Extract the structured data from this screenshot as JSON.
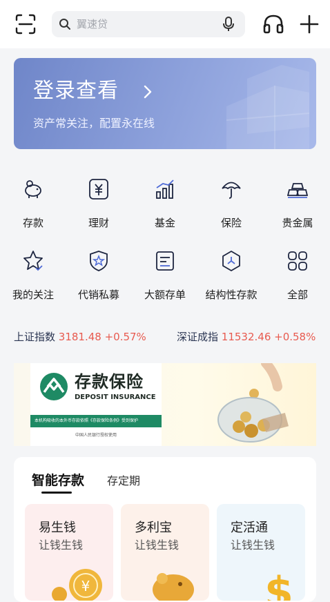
{
  "header": {
    "search_placeholder": "翼速贷"
  },
  "banner": {
    "title": "登录查看",
    "subtitle": "资产常关注，配置永在线"
  },
  "grid": [
    {
      "label": "存款",
      "icon": "piggy-bank-icon"
    },
    {
      "label": "理财",
      "icon": "yuan-wealth-icon"
    },
    {
      "label": "基金",
      "icon": "bar-chart-icon"
    },
    {
      "label": "保险",
      "icon": "umbrella-icon"
    },
    {
      "label": "贵金属",
      "icon": "gold-bars-icon"
    },
    {
      "label": "我的关注",
      "icon": "star-icon"
    },
    {
      "label": "代销私募",
      "icon": "shield-star-icon"
    },
    {
      "label": "大额存单",
      "icon": "certificate-icon"
    },
    {
      "label": "结构性存款",
      "icon": "hexagon-icon"
    },
    {
      "label": "全部",
      "icon": "all-grid-icon"
    }
  ],
  "indices": [
    {
      "name": "上证指数",
      "value": "3181.48 +0.57%"
    },
    {
      "name": "深证成指",
      "value": "11532.46 +0.58%"
    }
  ],
  "ad": {
    "title": "存款保险",
    "subtitle": "DEPOSIT INSURANCE",
    "strip_text": "本机构吸收的本外币存款依照《存款保险条例》受到保护",
    "footer": "中国人民银行授权使用",
    "brand_color": "#1e8a64"
  },
  "deposit": {
    "tabs": [
      "智能存款",
      "存定期"
    ],
    "products": [
      {
        "name": "易生钱",
        "desc": "让钱生钱",
        "bg": "#fdeeee"
      },
      {
        "name": "多利宝",
        "desc": "让钱生钱",
        "bg": "#fdf1ea"
      },
      {
        "name": "定活通",
        "desc": "让钱生钱",
        "bg": "#eef6fb"
      }
    ]
  },
  "colors": {
    "accent": "#7a8fd0",
    "index_up": "#e85a4f"
  }
}
